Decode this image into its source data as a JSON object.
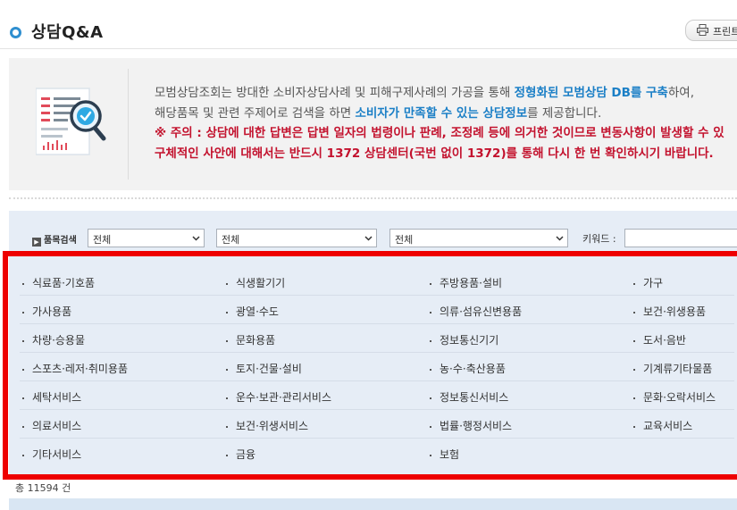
{
  "page": {
    "title": "상담Q&A",
    "print_label": "프린트"
  },
  "info": {
    "line1": {
      "pre": "모범상담조회는 방대한 소비자상담사례 및 피해구제사례의 가공을 통해 ",
      "hl1": "정형화된 모범상담 DB를 구축",
      "post": "하여,"
    },
    "line2": {
      "pre": "해당품목 및 관련 주제어로 검색을 하면 ",
      "hl1": "소비자가 만족할 수 있는 상담정보",
      "post": "를 제공합니다."
    },
    "line3": "※ 주의 : 상담에 대한 답변은 답변 일자의 법령이나 판례, 조정례 등에 의거한 것이므로 변동사항이 발생할 수 있",
    "line4": "구체적인 사안에 대해서는 반드시 1372 상담센터(국번 없이 1372)를 통해 다시 한 번 확인하시기 바랍니다."
  },
  "search": {
    "label": "품목검색",
    "select1": "전체",
    "select2": "전체",
    "select3": "전체",
    "keyword_label": "키워드 :",
    "keyword_value": ""
  },
  "categories": [
    [
      "식료품·기호품",
      "식생활기기",
      "주방용품·설비",
      "가구"
    ],
    [
      "가사용품",
      "광열·수도",
      "의류·섬유신변용품",
      "보건·위생용품"
    ],
    [
      "차량·승용물",
      "문화용품",
      "정보통신기기",
      "도서·음반"
    ],
    [
      "스포츠·레저·취미용품",
      "토지·건물·설비",
      "농·수·축산용품",
      "기계류기타물품"
    ],
    [
      "세탁서비스",
      "운수·보관·관리서비스",
      "정보통신서비스",
      "문화·오락서비스"
    ],
    [
      "의료서비스",
      "보건·위생서비스",
      "법률·행정서비스",
      "교육서비스"
    ],
    [
      "기타서비스",
      "금융",
      "보험",
      ""
    ]
  ],
  "total": "총 11594 건",
  "colors": {
    "accent": "#1b7fc6",
    "warning": "#c3122e",
    "highlight_frame": "#ee0000",
    "panel_bg": "#e6edf6"
  },
  "icons": {
    "title": "circle-bullet-icon",
    "print": "printer-icon",
    "illustration": "document-search-icon"
  }
}
